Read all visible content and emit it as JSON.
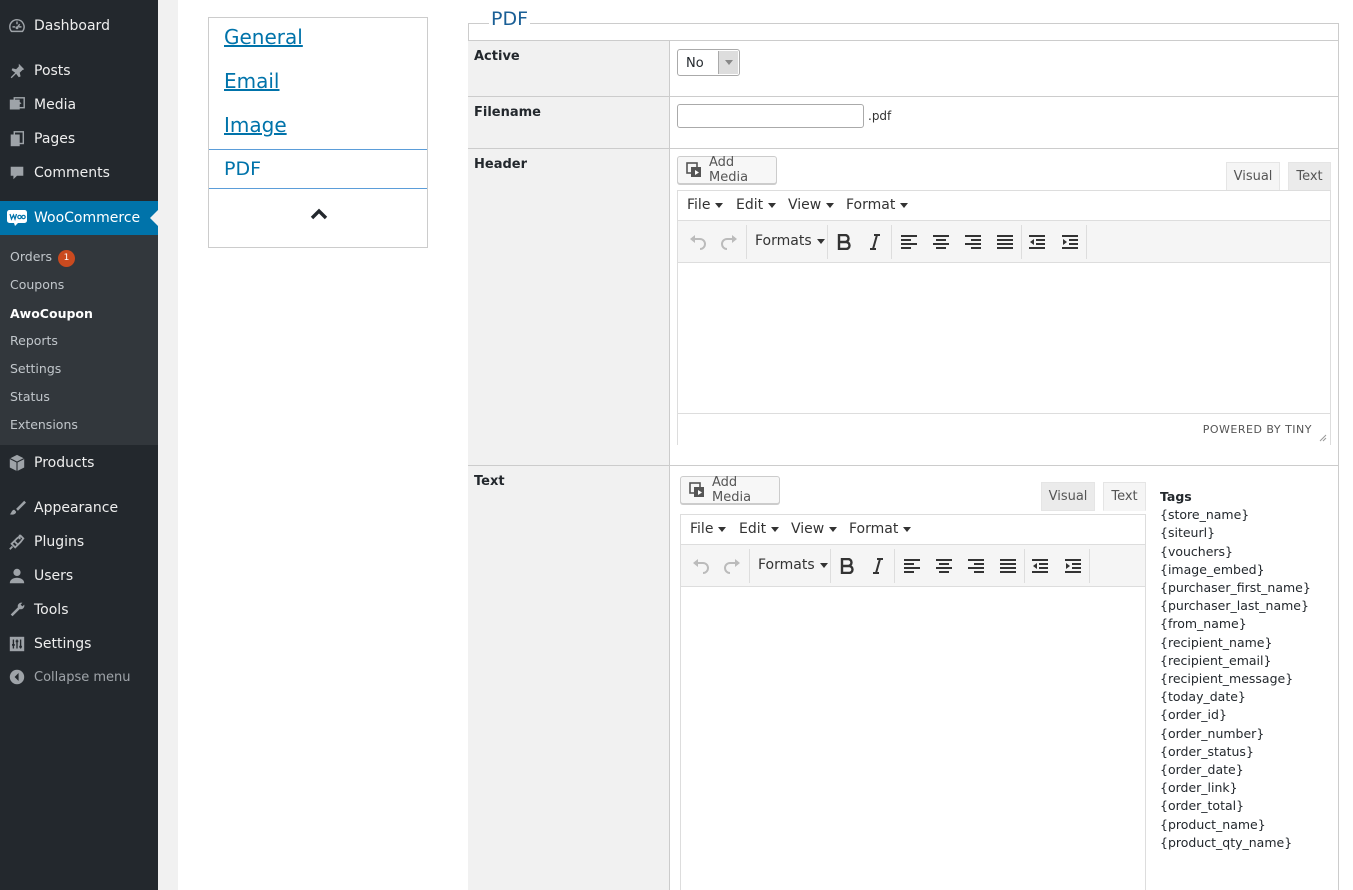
{
  "sidebar": {
    "items": [
      {
        "label": "Dashboard",
        "icon": "dashboard-icon"
      },
      {
        "label": "Posts",
        "icon": "pin-icon"
      },
      {
        "label": "Media",
        "icon": "media-icon"
      },
      {
        "label": "Pages",
        "icon": "pages-icon"
      },
      {
        "label": "Comments",
        "icon": "comment-icon"
      },
      {
        "label": "WooCommerce",
        "icon": "woo-icon"
      },
      {
        "label": "Products",
        "icon": "box-icon"
      },
      {
        "label": "Appearance",
        "icon": "brush-icon"
      },
      {
        "label": "Plugins",
        "icon": "plugin-icon"
      },
      {
        "label": "Users",
        "icon": "user-icon"
      },
      {
        "label": "Tools",
        "icon": "wrench-icon"
      },
      {
        "label": "Settings",
        "icon": "settings-icon"
      }
    ],
    "submenu": [
      "Orders",
      "Coupons",
      "AwoCoupon",
      "Reports",
      "Settings",
      "Status",
      "Extensions"
    ],
    "orders_badge": "1",
    "collapse_label": "Collapse menu",
    "accent": "#0073aa"
  },
  "sidenav": {
    "links": [
      "General",
      "Email",
      "Image",
      "PDF"
    ]
  },
  "section": {
    "legend": "PDF",
    "active": {
      "label": "Active",
      "value": "No"
    },
    "filename": {
      "label": "Filename",
      "value": "",
      "suffix": ".pdf"
    },
    "header": {
      "label": "Header"
    },
    "text": {
      "label": "Text"
    }
  },
  "editor": {
    "add_media": "Add Media",
    "tab_visual": "Visual",
    "tab_text": "Text",
    "menus": [
      "File",
      "Edit",
      "View",
      "Format"
    ],
    "formats": "Formats",
    "powered": "POWERED BY TINY"
  },
  "tags": {
    "title": "Tags",
    "list": [
      "{store_name}",
      "{siteurl}",
      "{vouchers}",
      "{image_embed}",
      "{purchaser_first_name}",
      "{purchaser_last_name}",
      "{from_name}",
      "{recipient_name}",
      "{recipient_email}",
      "{recipient_message}",
      "{today_date}",
      "{order_id}",
      "{order_number}",
      "{order_status}",
      "{order_date}",
      "{order_link}",
      "{order_total}",
      "{product_name}",
      "{product_qty_name}"
    ]
  }
}
